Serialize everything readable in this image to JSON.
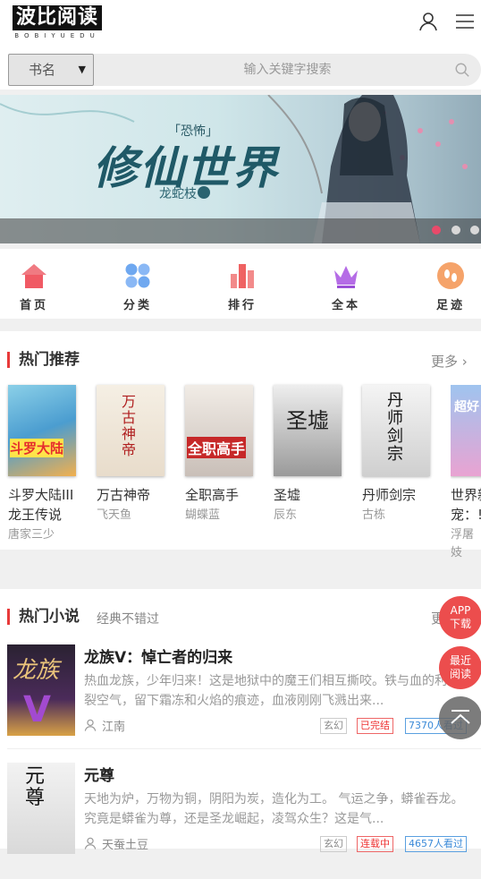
{
  "header": {
    "logo_main": "波比阅读",
    "logo_sub": "BOBIYUEDU"
  },
  "search": {
    "category": "书名",
    "placeholder": "输入关键字搜索"
  },
  "banner": {
    "tag": "「恐怖」",
    "title": "修仙世界",
    "author": "龙蛇枝"
  },
  "nav": {
    "home": "首页",
    "category": "分类",
    "rank": "排行",
    "complete": "全本",
    "history": "足迹"
  },
  "hot_recommend": {
    "title": "热门推荐",
    "more": "更多",
    "books": [
      {
        "title": "斗罗大陆III",
        "title2": "龙王传说",
        "author": "唐家三少",
        "cover_text": "斗罗大陆"
      },
      {
        "title": "万古神帝",
        "author": "飞天鱼",
        "cover_text": "万古神帝"
      },
      {
        "title": "全职高手",
        "author": "蝴蝶蓝",
        "cover_text": "全职高手"
      },
      {
        "title": "圣墟",
        "author": "辰东",
        "cover_text": "圣墟"
      },
      {
        "title": "丹师剑宗",
        "author": "古栋",
        "cover_text": "丹师剑宗"
      },
      {
        "title": "世界新",
        "title2": "宠：!",
        "author": "浮屠妓",
        "cover_text": "超好"
      }
    ]
  },
  "hot_novels": {
    "title": "热门小说",
    "subtitle": "经典不错过",
    "more": "更",
    "items": [
      {
        "title": "龙族Ⅴ：悼亡者的归来",
        "desc": "热血龙族，少年归来！这是地狱中的魔王们相互撕咬。铁与血的利爪撕裂空气，留下霜冻和火焰的痕迹，血液刚刚飞溅出来...",
        "author": "江南",
        "genre": "玄幻",
        "status": "已完结",
        "readers": "7370人看过",
        "cover_text": "龙族"
      },
      {
        "title": "元尊",
        "desc": "天地为炉，万物为铜，阴阳为炭，造化为工。 气运之争，蟒雀吞龙。 究竟是蟒雀为尊，还是圣龙崛起，凌驾众生？这是气...",
        "author": "天蚕土豆",
        "genre": "玄幻",
        "status": "连载中",
        "readers": "4657人看过",
        "cover_text": "元尊"
      }
    ]
  },
  "float": {
    "app": "APP下载",
    "app_line1": "APP",
    "app_line2": "下载",
    "recent_line1": "最近",
    "recent_line2": "阅读"
  },
  "colors": {
    "accent": "#e83a3a",
    "pink": "#e84a6a",
    "float": "#ec4d4d"
  }
}
